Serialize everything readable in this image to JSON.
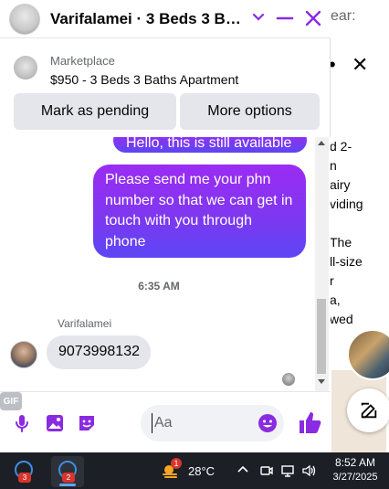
{
  "background": {
    "search_fragment": "ear:",
    "description_fragment": "d 2-\nn\nairy\nviding\n\nThe\nll-size\nr\na,\nwed"
  },
  "chat": {
    "title": "Varifalamei · 3 Beds 3 Bath…",
    "accent_color": "#8a2be2",
    "listing": {
      "source": "Marketplace",
      "title": "$950 - 3 Beds 3 Baths Apartment"
    },
    "buttons": {
      "mark_pending": "Mark as pending",
      "more_options": "More options"
    },
    "messages": {
      "outgoing_partial": "Hello, this is still available",
      "outgoing_main": "Please send me your phn number so that we can get in touch with you through phone",
      "timestamp": "6:35 AM",
      "sender_name": "Varifalamei",
      "incoming": "9073998132"
    },
    "composer": {
      "placeholder": "Aa",
      "gif_label": "GIF"
    }
  },
  "taskbar": {
    "app1_badge": "3",
    "app2_badge": "2",
    "weather_badge": "1",
    "temperature": "28°C",
    "time": "8:52 AM",
    "date": "3/27/2025"
  }
}
